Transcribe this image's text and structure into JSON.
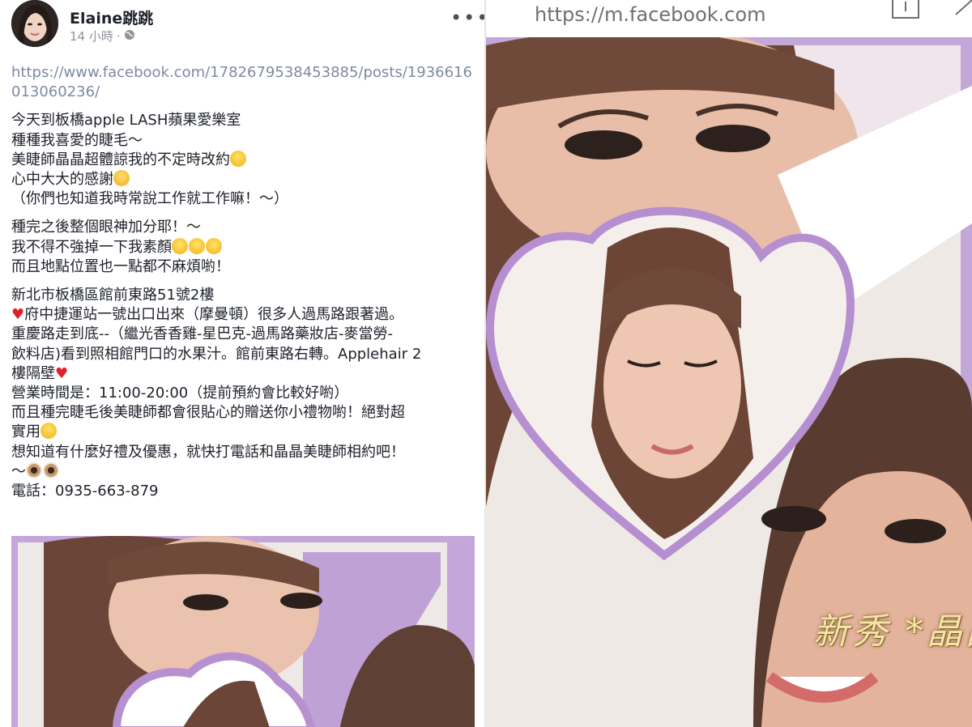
{
  "post": {
    "author": "Elaine跳跳",
    "time": "14 小時",
    "dot": "·",
    "more": "•••",
    "link": "https://www.facebook.com/1782679538453885/posts/1936616013060236/",
    "paragraphs": [
      [
        "今天到板橋apple LASH蘋果愛樂室",
        "種種我喜愛的睫毛～",
        "美睫師晶晶超體諒我的不定時改約",
        "心中大大的感謝",
        "（你們也知道我時常說工作就工作嘛！～）"
      ],
      [
        "種完之後整個眼神加分耶！～",
        "我不得不強掉一下我素顏",
        "而且地點位置也一點都不麻煩喲！"
      ],
      [
        "新北市板橋區館前東路51號2樓",
        "府中捷運站一號出口出來（摩曼頓）很多人過馬路跟著過。",
        "重慶路走到底--（繼光香香雞-星巴克-過馬路藥妝店-麥當勞-",
        "飲料店)看到照相館門口的水果汁。館前東路右轉。Applehair 2",
        "樓隔壁",
        "營業時間是：11:00-20:00（提前預約會比較好喲）",
        "而且種完睫毛後美睫師都會很貼心的贈送你小禮物喲！絕對超",
        "實用",
        "想知道有什麼好禮及優惠，就快打電話和晶晶美睫師相約吧！",
        "～",
        "電話：0935-663-879"
      ]
    ]
  },
  "browser": {
    "url": "https://m.facebook.com"
  },
  "photo": {
    "caption": "新秀 *晶晶美睫師*"
  },
  "colors": {
    "frame_purple": "#c7a6dd",
    "link": "#7d8aa3",
    "caption": "#f5e4a2"
  }
}
